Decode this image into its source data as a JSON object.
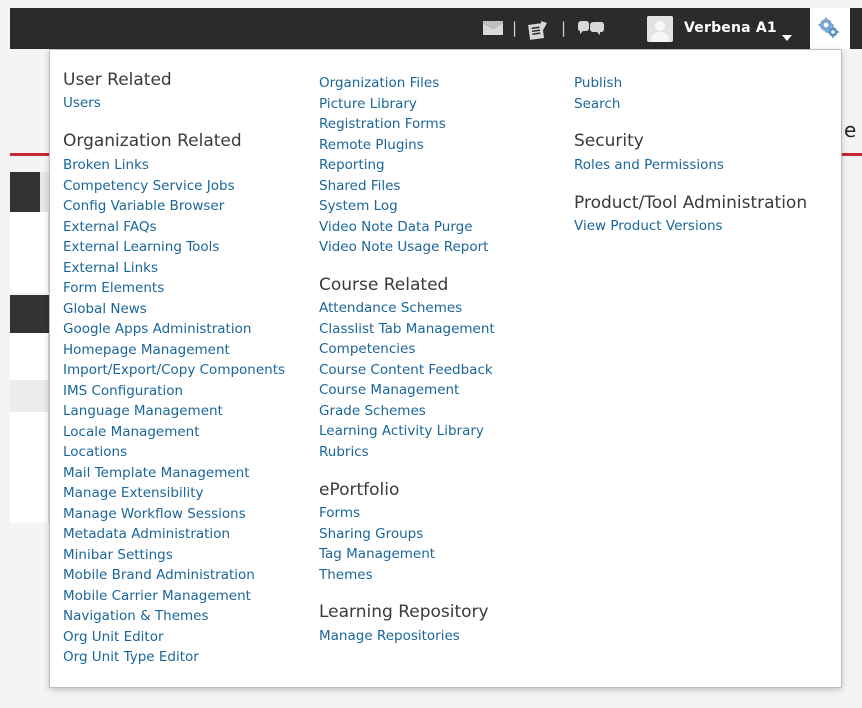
{
  "minibar": {
    "user_name": "Verbena A1",
    "icons": [
      "message-alerts-icon",
      "update-alerts-icon",
      "subscription-alerts-icon",
      "admin-tools-gear-icon"
    ],
    "colors": {
      "bar": "#2b2b2b",
      "link": "#1b6699",
      "accent_red": "#c6282d"
    }
  },
  "admin_menu": {
    "col1": {
      "user_related": {
        "heading": "User Related",
        "items": [
          "Users"
        ]
      },
      "organization_related": {
        "heading": "Organization Related",
        "items": [
          "Broken Links",
          "Competency Service Jobs",
          "Config Variable Browser",
          "External FAQs",
          "External Learning Tools",
          "External Links",
          "Form Elements",
          "Global News",
          "Google Apps Administration",
          "Homepage Management",
          "Import/Export/Copy Components",
          "IMS Configuration",
          "Language Management",
          "Locale Management",
          "Locations",
          "Mail Template Management",
          "Manage Extensibility",
          "Manage Workflow Sessions",
          "Metadata Administration",
          "Minibar Settings",
          "Mobile Brand Administration",
          "Mobile Carrier Management",
          "Navigation & Themes",
          "Org Unit Editor",
          "Org Unit Type Editor"
        ]
      }
    },
    "col2": {
      "org_continued": {
        "items": [
          "Organization Files",
          "Picture Library",
          "Registration Forms",
          "Remote Plugins",
          "Reporting",
          "Shared Files",
          "System Log",
          "Video Note Data Purge",
          "Video Note Usage Report"
        ]
      },
      "course_related": {
        "heading": "Course Related",
        "items": [
          "Attendance Schemes",
          "Classlist Tab Management",
          "Competencies",
          "Course Content Feedback",
          "Course Management",
          "Grade Schemes",
          "Learning Activity Library",
          "Rubrics"
        ]
      },
      "eportfolio": {
        "heading": "ePortfolio",
        "items": [
          "Forms",
          "Sharing Groups",
          "Tag Management",
          "Themes"
        ]
      },
      "learning_repository": {
        "heading": "Learning Repository",
        "items": [
          "Manage Repositories"
        ]
      }
    },
    "col3": {
      "org_continued": {
        "items": [
          "Publish",
          "Search"
        ]
      },
      "security": {
        "heading": "Security",
        "items": [
          "Roles and Permissions"
        ]
      },
      "product_tool": {
        "heading": "Product/Tool Administration",
        "items": [
          "View Product Versions"
        ]
      }
    }
  }
}
